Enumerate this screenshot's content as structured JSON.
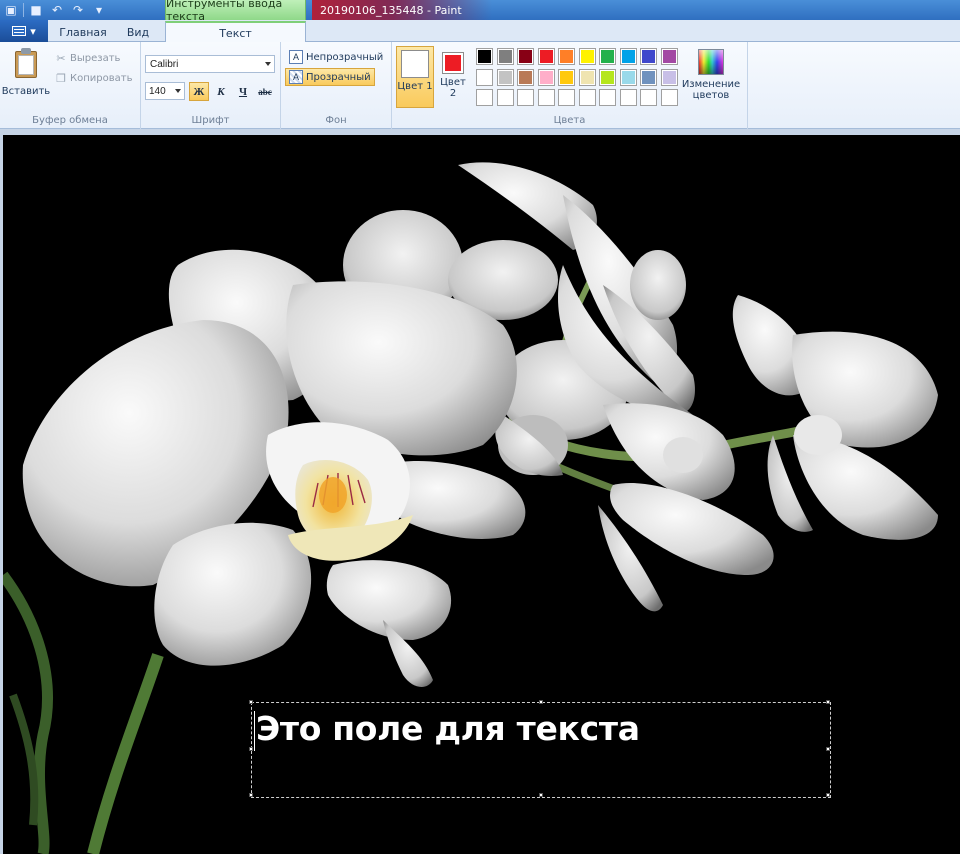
{
  "titlebar": {
    "context_tab_title": "Инструменты ввода текста",
    "window_title": "20190106_135448 - Paint"
  },
  "tabs": {
    "home": "Главная",
    "view": "Вид",
    "text": "Текст"
  },
  "clipboard": {
    "paste": "Вставить",
    "cut": "Вырезать",
    "copy": "Копировать",
    "group_label": "Буфер обмена"
  },
  "font": {
    "family": "Calibri",
    "size": "140",
    "bold": "Ж",
    "italic": "К",
    "underline": "Ч",
    "strikethrough": "abc",
    "group_label": "Шрифт"
  },
  "background": {
    "opaque": "Непрозрачный",
    "transparent": "Прозрачный",
    "group_label": "Фон",
    "selected": "Прозрачный"
  },
  "colors": {
    "color1_label": "Цвет 1",
    "color2_label": "Цвет 2",
    "color1_value": "#ffffff",
    "color2_value": "#ed1c24",
    "edit_label": "Изменение цветов",
    "group_label": "Цвета",
    "palette": [
      "#000000",
      "#7f7f7f",
      "#880015",
      "#ed1c24",
      "#ff7f27",
      "#fff200",
      "#22b14c",
      "#00a2e8",
      "#3f48cc",
      "#a349a4",
      "#ffffff",
      "#c3c3c3",
      "#b97a57",
      "#ffaec9",
      "#ffc90e",
      "#efe4b0",
      "#b5e61d",
      "#99d9ea",
      "#7092be",
      "#c8bfe7",
      "#ffffff",
      "#ffffff",
      "#ffffff",
      "#ffffff",
      "#ffffff",
      "#ffffff",
      "#ffffff",
      "#ffffff",
      "#ffffff",
      "#ffffff"
    ]
  },
  "canvas": {
    "text_content": "Это поле для текста"
  }
}
